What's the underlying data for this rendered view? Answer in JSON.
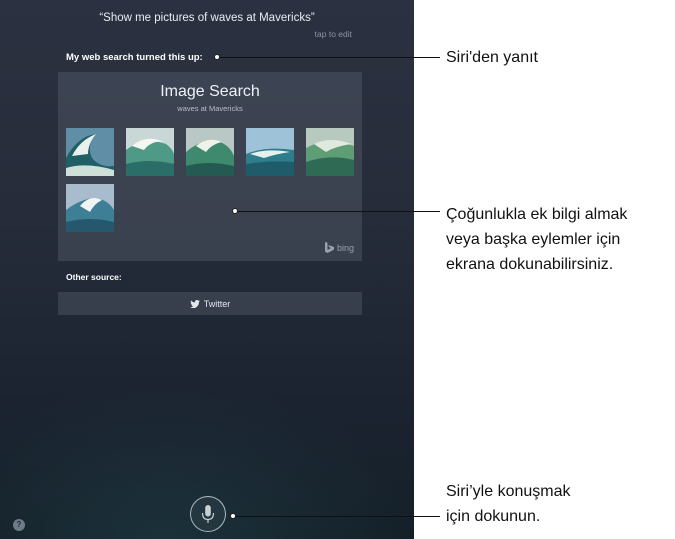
{
  "siri": {
    "query": "“Show me pictures of waves at Mavericks”",
    "tap_to_edit": "tap to edit",
    "response": "My web search turned this up:",
    "card": {
      "title": "Image Search",
      "subtitle": "waves at Mavericks",
      "thumbnails": [
        {
          "label": "wave-image-1"
        },
        {
          "label": "wave-image-2"
        },
        {
          "label": "wave-image-3"
        },
        {
          "label": "wave-image-4"
        },
        {
          "label": "wave-image-5"
        },
        {
          "label": "wave-image-6"
        }
      ],
      "provider": "bing"
    },
    "other_source_label": "Other source:",
    "twitter_label": "Twitter",
    "help_label": "?"
  },
  "callouts": {
    "response": "Siri'den yanıt",
    "tap_info_line1": "Çoğunlukla ek bilgi almak",
    "tap_info_line2": "veya başka eylemler için",
    "tap_info_line3": "ekrana dokunabilirsiniz.",
    "speak_line1": "Siri’yle konuşmak",
    "speak_line2": "için dokunun."
  },
  "colors": {
    "background_top": "#2b3140",
    "background_bottom": "#142028",
    "card": "#58606e",
    "callout_text": "#111111"
  },
  "icons": [
    "bing-icon",
    "twitter-bird-icon",
    "microphone-icon",
    "help-icon"
  ]
}
